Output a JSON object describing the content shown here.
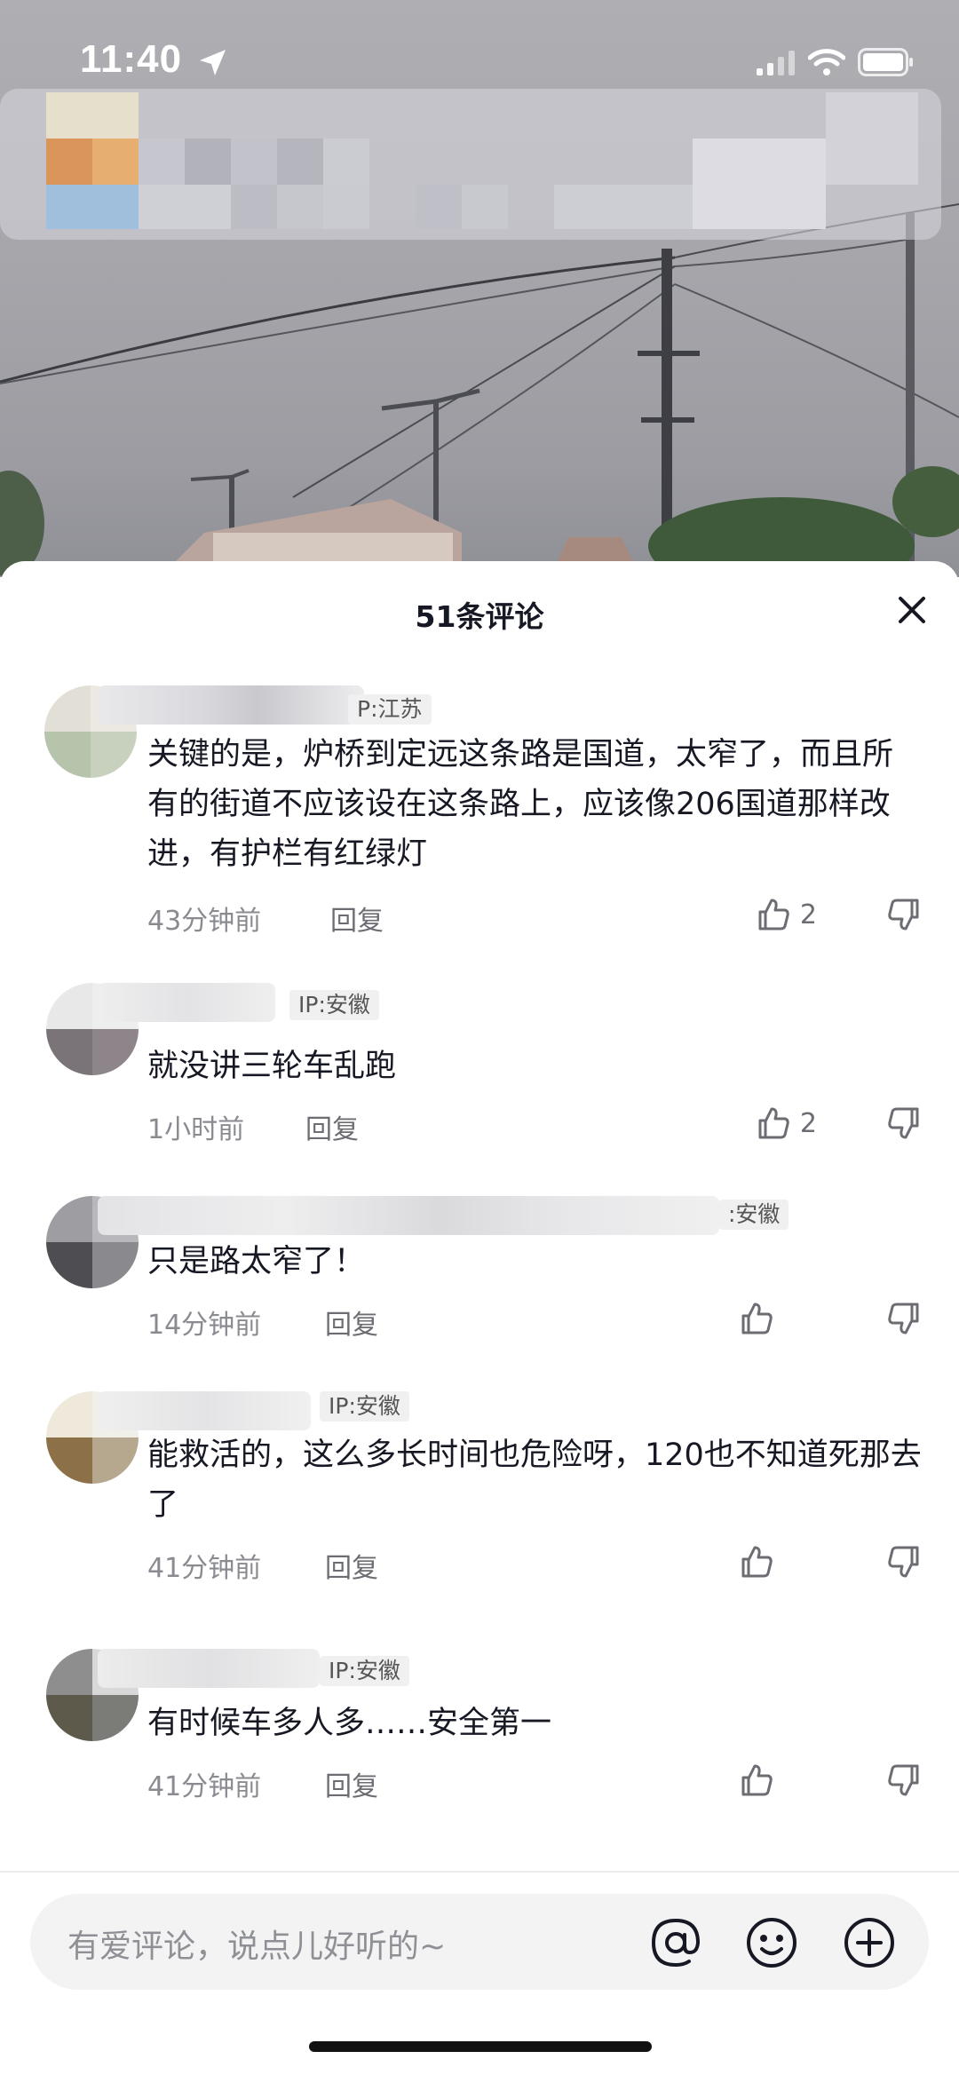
{
  "status_bar": {
    "time": "11:40"
  },
  "sheet": {
    "title": "51条评论"
  },
  "comments": [
    {
      "ip": "P:江苏",
      "text": "关键的是，炉桥到定远这条路是国道，太窄了，而且所有的街道不应该设在这条路上，应该像206国道那样改进，有护栏有红绿灯",
      "time": "43分钟前",
      "reply": "回复",
      "likes": "2"
    },
    {
      "ip": "IP:安徽",
      "text": "就没讲三轮车乱跑",
      "time": "1小时前",
      "reply": "回复",
      "likes": "2"
    },
    {
      "ip": ":安徽",
      "text": "只是路太窄了！",
      "time": "14分钟前",
      "reply": "回复",
      "likes": ""
    },
    {
      "ip": "IP:安徽",
      "text": "能救活的，这么多长时间也危险呀，120也不知道死那去了",
      "time": "41分钟前",
      "reply": "回复",
      "likes": ""
    },
    {
      "ip": "IP:安徽",
      "text": "有时候车多人多……安全第一",
      "time": "41分钟前",
      "reply": "回复",
      "likes": ""
    }
  ],
  "input": {
    "placeholder": "有爱评论，说点儿好听的~"
  },
  "icons": {
    "location": "location-arrow-icon",
    "signal": "signal-icon",
    "wifi": "wifi-icon",
    "battery": "battery-icon",
    "close": "close-icon",
    "like": "thumbs-up-icon",
    "dislike": "thumbs-down-icon",
    "mention": "at-icon",
    "emoji": "emoji-icon",
    "add": "plus-circle-icon"
  }
}
